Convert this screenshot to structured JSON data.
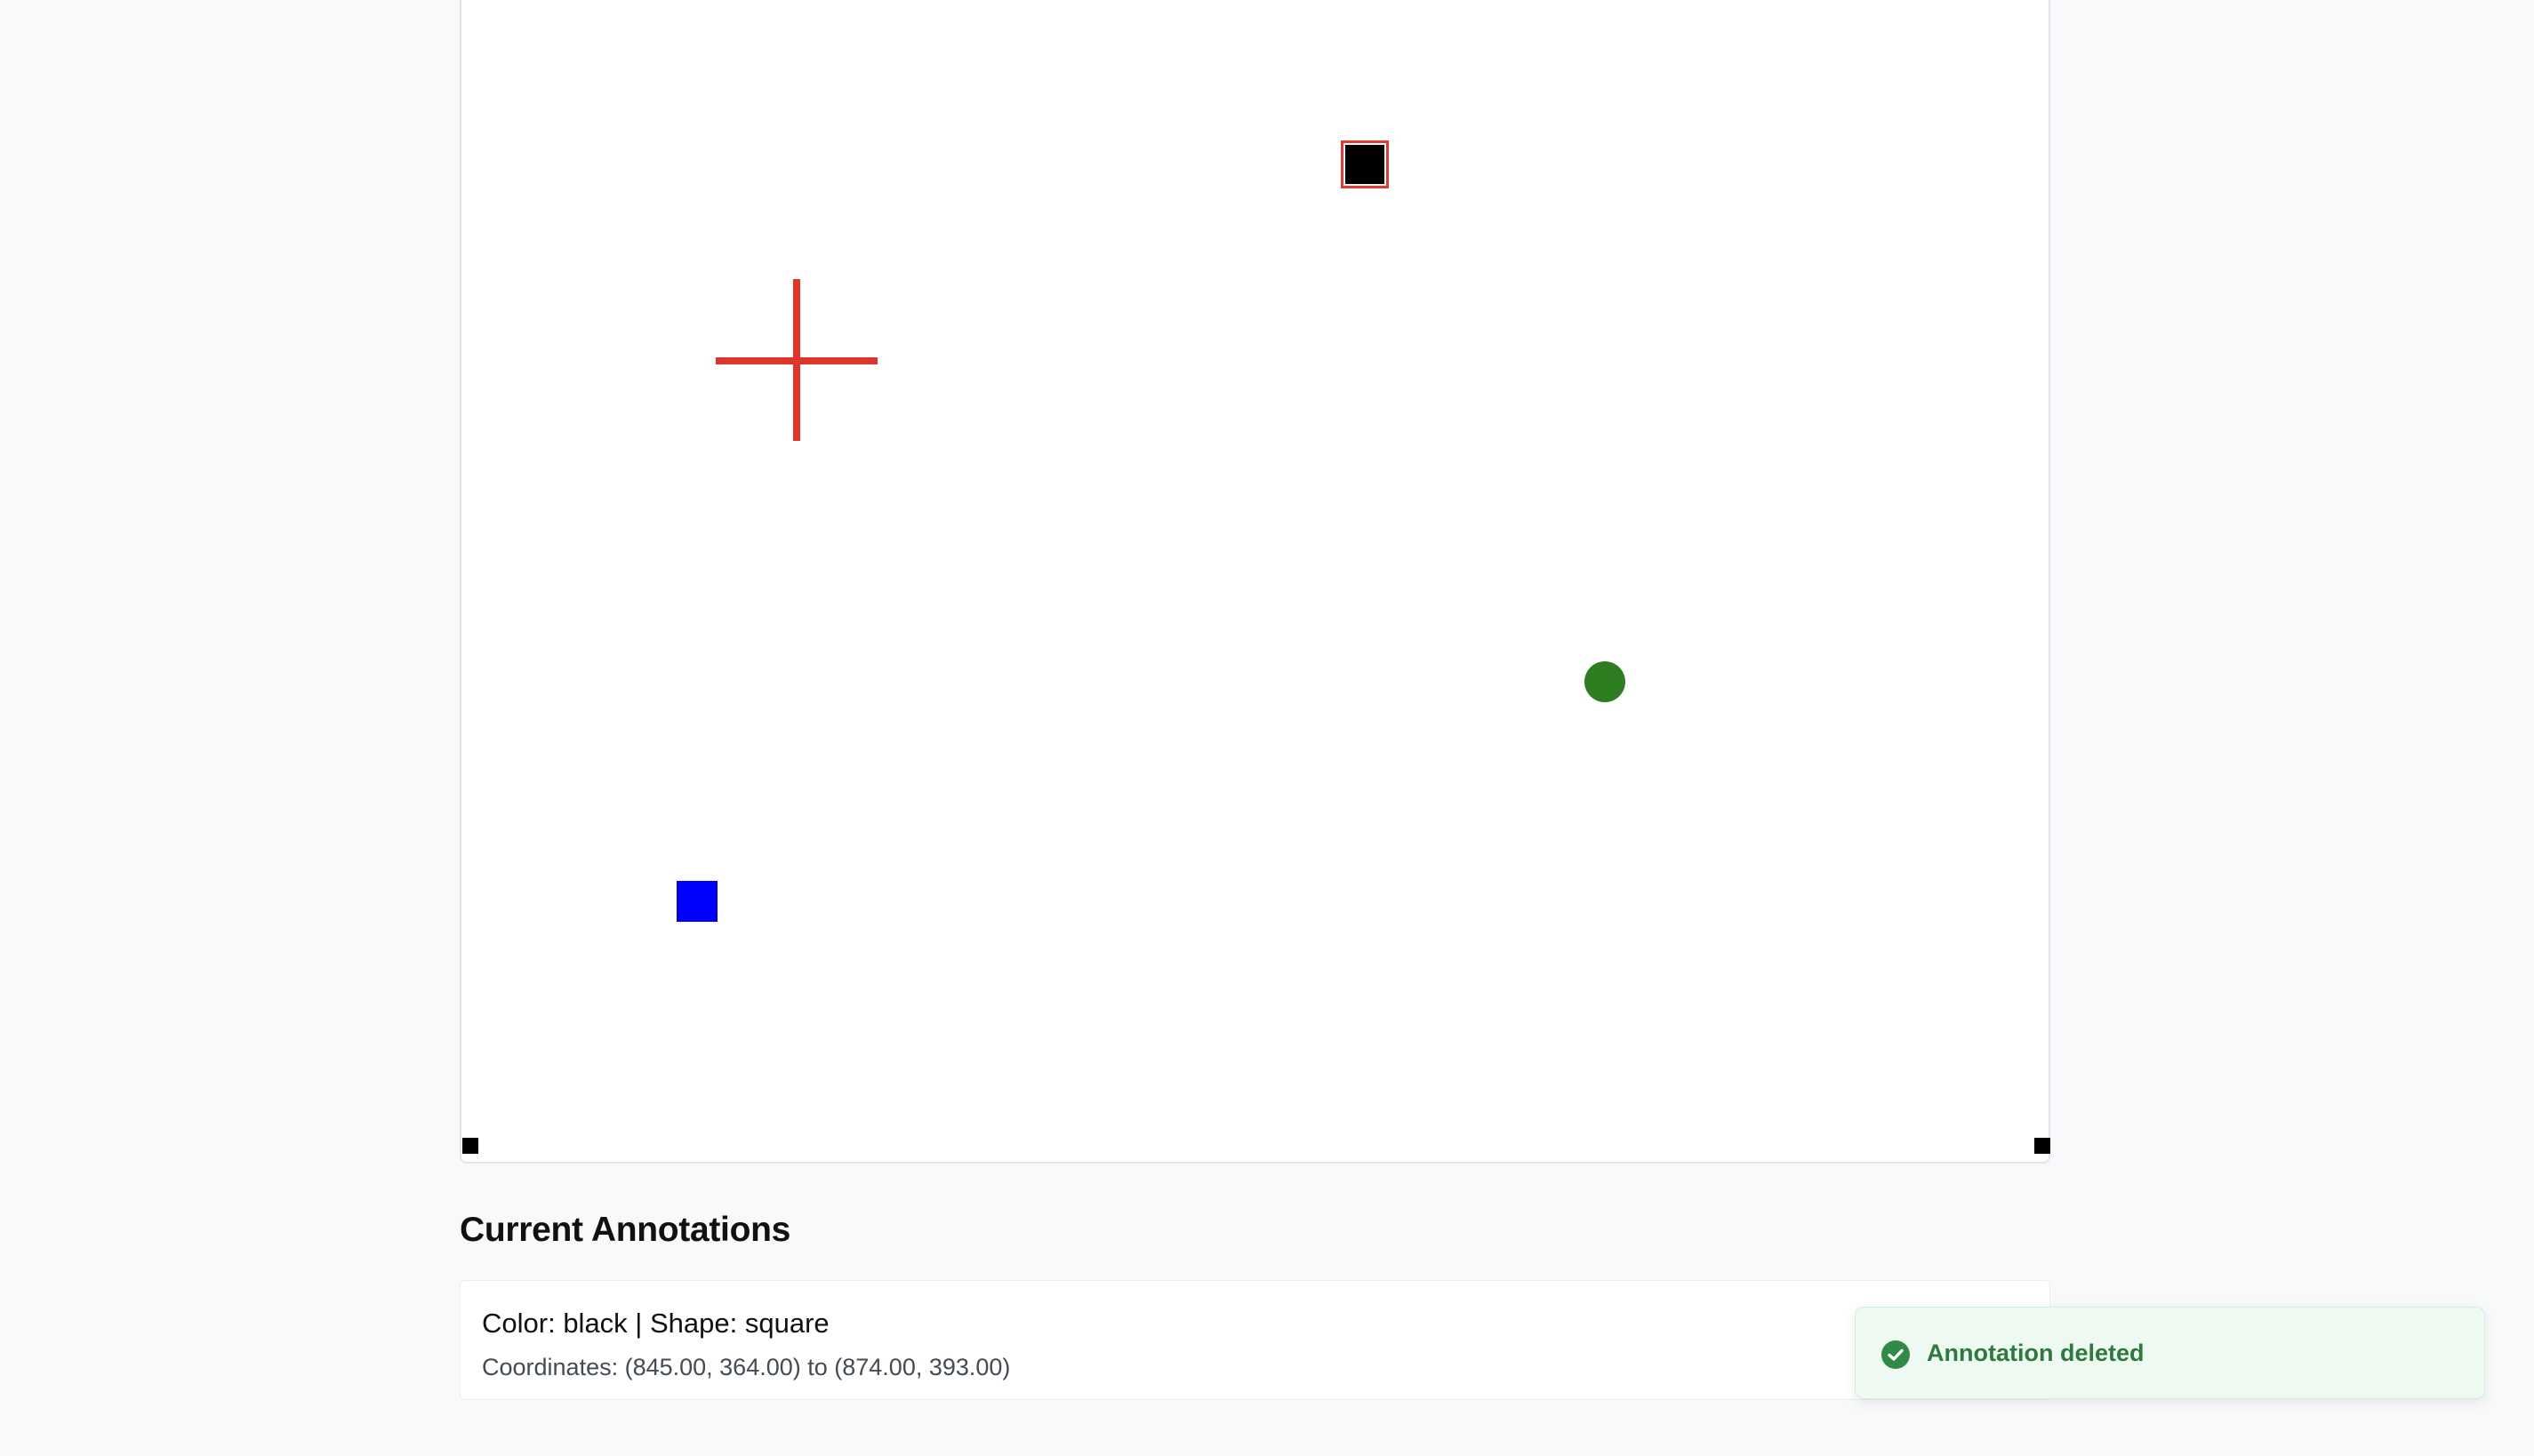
{
  "canvas": {
    "shapes": [
      {
        "shape": "square",
        "color": "black",
        "selected": true
      },
      {
        "shape": "crosshair",
        "color": "red"
      },
      {
        "shape": "circle",
        "color": "green"
      },
      {
        "shape": "square",
        "color": "blue"
      }
    ]
  },
  "annotations": {
    "title": "Current Annotations",
    "items": [
      {
        "color_label": "Color: ",
        "color_value": "black",
        "separator": " | ",
        "shape_label": "Shape: ",
        "shape_value": "square",
        "coordinates": "Coordinates: (845.00, 364.00) to (874.00, 393.00)"
      }
    ]
  },
  "toast": {
    "message": "Annotation deleted",
    "icon": "check-circle-icon",
    "color": "#2d7a3e"
  },
  "colors": {
    "selection_outline": "#e53a2f",
    "crosshair": "#e0352b",
    "green": "#2f7d21",
    "blue": "#0000ff"
  }
}
